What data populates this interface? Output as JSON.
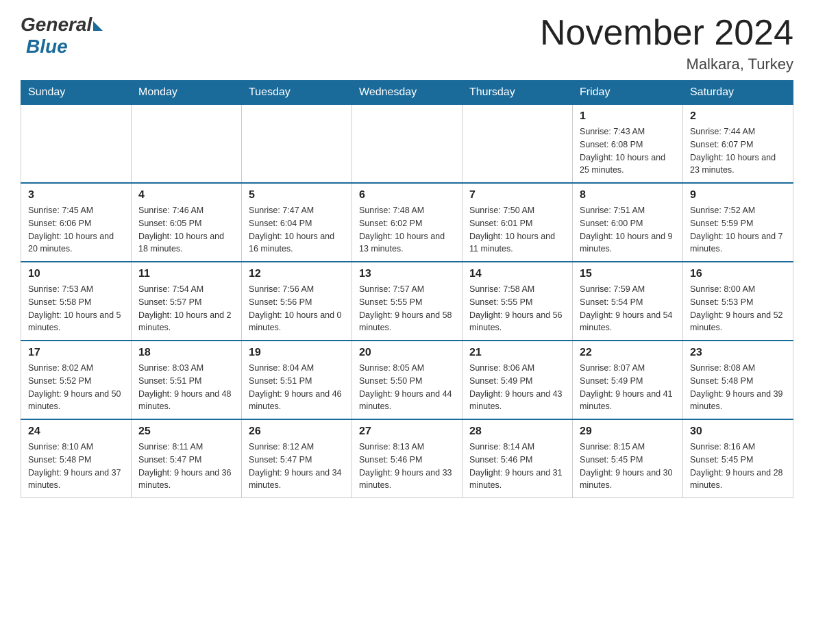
{
  "logo": {
    "general": "General",
    "blue": "Blue"
  },
  "title": "November 2024",
  "location": "Malkara, Turkey",
  "days_of_week": [
    "Sunday",
    "Monday",
    "Tuesday",
    "Wednesday",
    "Thursday",
    "Friday",
    "Saturday"
  ],
  "weeks": [
    [
      {
        "day": "",
        "info": ""
      },
      {
        "day": "",
        "info": ""
      },
      {
        "day": "",
        "info": ""
      },
      {
        "day": "",
        "info": ""
      },
      {
        "day": "",
        "info": ""
      },
      {
        "day": "1",
        "info": "Sunrise: 7:43 AM\nSunset: 6:08 PM\nDaylight: 10 hours and 25 minutes."
      },
      {
        "day": "2",
        "info": "Sunrise: 7:44 AM\nSunset: 6:07 PM\nDaylight: 10 hours and 23 minutes."
      }
    ],
    [
      {
        "day": "3",
        "info": "Sunrise: 7:45 AM\nSunset: 6:06 PM\nDaylight: 10 hours and 20 minutes."
      },
      {
        "day": "4",
        "info": "Sunrise: 7:46 AM\nSunset: 6:05 PM\nDaylight: 10 hours and 18 minutes."
      },
      {
        "day": "5",
        "info": "Sunrise: 7:47 AM\nSunset: 6:04 PM\nDaylight: 10 hours and 16 minutes."
      },
      {
        "day": "6",
        "info": "Sunrise: 7:48 AM\nSunset: 6:02 PM\nDaylight: 10 hours and 13 minutes."
      },
      {
        "day": "7",
        "info": "Sunrise: 7:50 AM\nSunset: 6:01 PM\nDaylight: 10 hours and 11 minutes."
      },
      {
        "day": "8",
        "info": "Sunrise: 7:51 AM\nSunset: 6:00 PM\nDaylight: 10 hours and 9 minutes."
      },
      {
        "day": "9",
        "info": "Sunrise: 7:52 AM\nSunset: 5:59 PM\nDaylight: 10 hours and 7 minutes."
      }
    ],
    [
      {
        "day": "10",
        "info": "Sunrise: 7:53 AM\nSunset: 5:58 PM\nDaylight: 10 hours and 5 minutes."
      },
      {
        "day": "11",
        "info": "Sunrise: 7:54 AM\nSunset: 5:57 PM\nDaylight: 10 hours and 2 minutes."
      },
      {
        "day": "12",
        "info": "Sunrise: 7:56 AM\nSunset: 5:56 PM\nDaylight: 10 hours and 0 minutes."
      },
      {
        "day": "13",
        "info": "Sunrise: 7:57 AM\nSunset: 5:55 PM\nDaylight: 9 hours and 58 minutes."
      },
      {
        "day": "14",
        "info": "Sunrise: 7:58 AM\nSunset: 5:55 PM\nDaylight: 9 hours and 56 minutes."
      },
      {
        "day": "15",
        "info": "Sunrise: 7:59 AM\nSunset: 5:54 PM\nDaylight: 9 hours and 54 minutes."
      },
      {
        "day": "16",
        "info": "Sunrise: 8:00 AM\nSunset: 5:53 PM\nDaylight: 9 hours and 52 minutes."
      }
    ],
    [
      {
        "day": "17",
        "info": "Sunrise: 8:02 AM\nSunset: 5:52 PM\nDaylight: 9 hours and 50 minutes."
      },
      {
        "day": "18",
        "info": "Sunrise: 8:03 AM\nSunset: 5:51 PM\nDaylight: 9 hours and 48 minutes."
      },
      {
        "day": "19",
        "info": "Sunrise: 8:04 AM\nSunset: 5:51 PM\nDaylight: 9 hours and 46 minutes."
      },
      {
        "day": "20",
        "info": "Sunrise: 8:05 AM\nSunset: 5:50 PM\nDaylight: 9 hours and 44 minutes."
      },
      {
        "day": "21",
        "info": "Sunrise: 8:06 AM\nSunset: 5:49 PM\nDaylight: 9 hours and 43 minutes."
      },
      {
        "day": "22",
        "info": "Sunrise: 8:07 AM\nSunset: 5:49 PM\nDaylight: 9 hours and 41 minutes."
      },
      {
        "day": "23",
        "info": "Sunrise: 8:08 AM\nSunset: 5:48 PM\nDaylight: 9 hours and 39 minutes."
      }
    ],
    [
      {
        "day": "24",
        "info": "Sunrise: 8:10 AM\nSunset: 5:48 PM\nDaylight: 9 hours and 37 minutes."
      },
      {
        "day": "25",
        "info": "Sunrise: 8:11 AM\nSunset: 5:47 PM\nDaylight: 9 hours and 36 minutes."
      },
      {
        "day": "26",
        "info": "Sunrise: 8:12 AM\nSunset: 5:47 PM\nDaylight: 9 hours and 34 minutes."
      },
      {
        "day": "27",
        "info": "Sunrise: 8:13 AM\nSunset: 5:46 PM\nDaylight: 9 hours and 33 minutes."
      },
      {
        "day": "28",
        "info": "Sunrise: 8:14 AM\nSunset: 5:46 PM\nDaylight: 9 hours and 31 minutes."
      },
      {
        "day": "29",
        "info": "Sunrise: 8:15 AM\nSunset: 5:45 PM\nDaylight: 9 hours and 30 minutes."
      },
      {
        "day": "30",
        "info": "Sunrise: 8:16 AM\nSunset: 5:45 PM\nDaylight: 9 hours and 28 minutes."
      }
    ]
  ],
  "colors": {
    "header_bg": "#1a6a9a",
    "header_text": "#ffffff",
    "border": "#1a6a9a"
  }
}
